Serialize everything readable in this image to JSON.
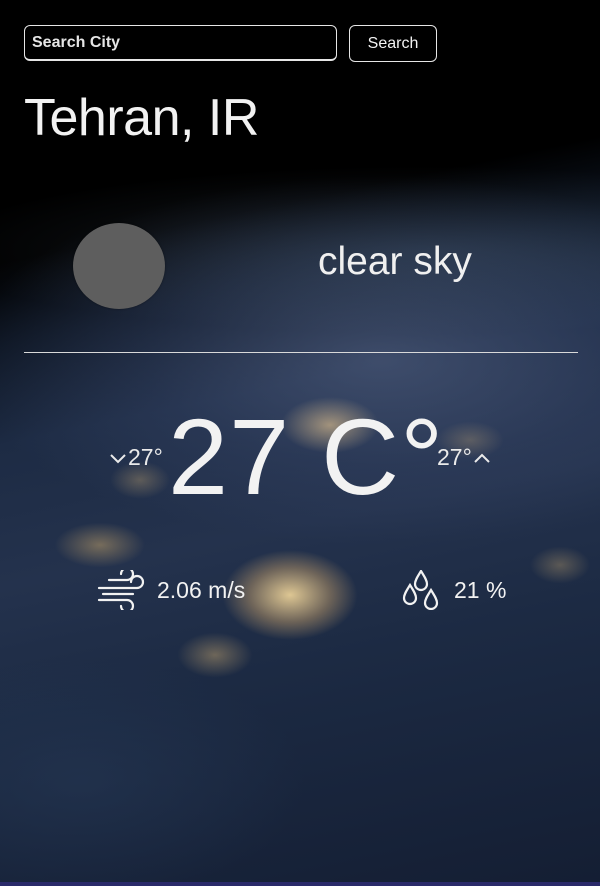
{
  "search": {
    "placeholder": "Search City",
    "button_label": "Search"
  },
  "location": {
    "city": "Tehran, IR"
  },
  "weather": {
    "description": "clear sky",
    "icon": "weather-icon-placeholder"
  },
  "temperature": {
    "main": "27 C°",
    "min": "27°",
    "max": "27°"
  },
  "stats": {
    "wind": "2.06 m/s",
    "humidity": "21 %"
  },
  "icons": {
    "min": "chevron-down-icon",
    "max": "chevron-up-icon",
    "wind": "wind-icon",
    "humidity": "water-drops-icon"
  }
}
